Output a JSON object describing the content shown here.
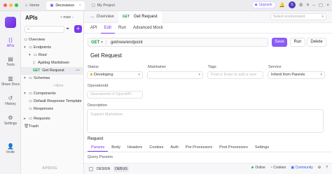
{
  "topbar": {
    "tabs": [
      {
        "label": "Home"
      },
      {
        "label": "Deceuseus"
      },
      {
        "label": "My Project"
      }
    ],
    "upgrade_label": "Upgrade",
    "avatar_letter": "S"
  },
  "rail": {
    "items": [
      {
        "label": "APIs",
        "icon": "api-icon"
      },
      {
        "label": "Tests",
        "icon": "tests-icon"
      },
      {
        "label": "Share Docs",
        "icon": "share-docs-icon"
      },
      {
        "label": "History",
        "icon": "history-icon"
      },
      {
        "label": "Settings",
        "icon": "settings-icon"
      },
      {
        "label": "Invite",
        "icon": "invite-icon"
      }
    ]
  },
  "sidebar": {
    "title": "APIs",
    "branch": "main",
    "overview": "Overview",
    "endpoints": "Endpoints",
    "root": "Root",
    "apidog_markdown": "Apidog Markdown",
    "get_method": "GET",
    "get_request": "Get Request",
    "schemas": "Schemas",
    "more": "• More",
    "components": "Components",
    "default_response_template": "Default Response Template",
    "responses": "Responses",
    "requests": "Requests",
    "trash": "Trash",
    "footer_logo": "APIDOG"
  },
  "main": {
    "tabs": [
      {
        "label": "Overview"
      },
      {
        "method": "GET",
        "label": "Get Request"
      }
    ],
    "env_placeholder": "Select environment",
    "subtabs": [
      "API",
      "Edit",
      "Run",
      "Advanced Mock"
    ],
    "url": {
      "method": "GET",
      "path": "get/new/endpoint"
    },
    "buttons": {
      "save": "Save",
      "run": "Run",
      "delete": "Delete"
    },
    "api_name": "Get Request",
    "fields": {
      "status_label": "Status",
      "status_value": "Developing",
      "maintainer_label": "Maintainer",
      "tags_label": "Tags",
      "tags_placeholder": "Find or Enter to add a new",
      "service_label": "Service",
      "service_value": "Inherit from Parents",
      "operation_label": "OperationId",
      "operation_placeholder": "OperationId of OpenAPI",
      "description_label": "Description",
      "description_placeholder": "Support Markdown"
    },
    "request_label": "Request",
    "request_tabs": [
      "Params",
      "Body",
      "Headers",
      "Cookies",
      "Auth",
      "Pre Processors",
      "Post Processors",
      "Settings"
    ],
    "query_params_label": "Query Params"
  },
  "statusbar": {
    "design": "DESIGN",
    "debug": "DEBUG",
    "online": "Online",
    "cookies": "Cookies",
    "community": "Community"
  }
}
